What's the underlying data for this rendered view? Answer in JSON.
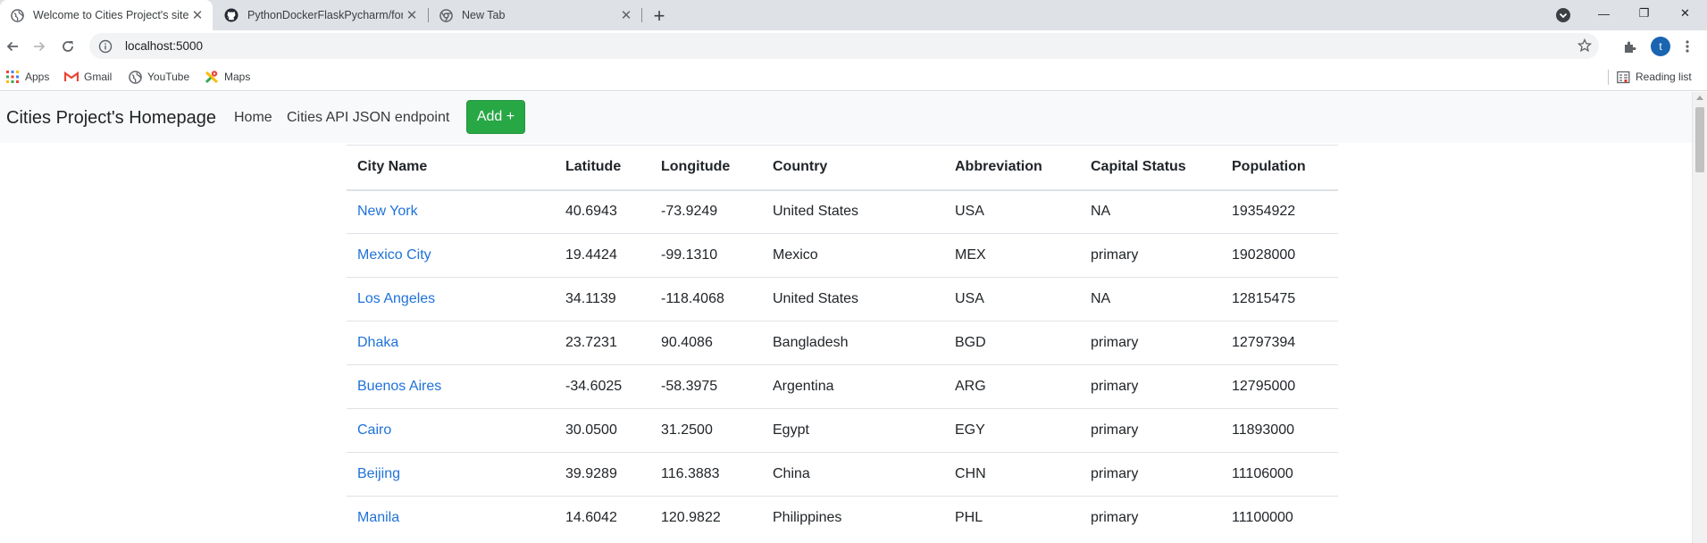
{
  "browser": {
    "tabs": [
      {
        "title": "Welcome to Cities Project's site",
        "icon": "globe-icon",
        "active": true
      },
      {
        "title": "PythonDockerFlaskPycharm/form",
        "icon": "github-icon",
        "active": false
      },
      {
        "title": "New Tab",
        "icon": "chrome-icon",
        "active": false
      }
    ],
    "close_glyph": "✕",
    "new_tab_glyph": "+",
    "window_controls": {
      "minimize": "—",
      "restore": "❐",
      "close": "✕"
    },
    "url": "localhost:5000",
    "profile_initial": "t",
    "bookmarks": [
      {
        "label": "Apps",
        "icon": "apps-grid-icon"
      },
      {
        "label": "Gmail",
        "icon": "gmail-icon"
      },
      {
        "label": "YouTube",
        "icon": "globe-icon"
      },
      {
        "label": "Maps",
        "icon": "maps-icon"
      }
    ],
    "reading_list": "Reading list"
  },
  "navbar": {
    "brand": "Cities Project's Homepage",
    "links": [
      "Home",
      "Cities API JSON endpoint"
    ],
    "add_button": "Add +"
  },
  "table": {
    "columns": [
      "City Name",
      "Latitude",
      "Longitude",
      "Country",
      "Abbreviation",
      "Capital Status",
      "Population"
    ],
    "rows": [
      [
        "New York",
        "40.6943",
        "-73.9249",
        "United States",
        "USA",
        "NA",
        "19354922"
      ],
      [
        "Mexico City",
        "19.4424",
        "-99.1310",
        "Mexico",
        "MEX",
        "primary",
        "19028000"
      ],
      [
        "Los Angeles",
        "34.1139",
        "-118.4068",
        "United States",
        "USA",
        "NA",
        "12815475"
      ],
      [
        "Dhaka",
        "23.7231",
        "90.4086",
        "Bangladesh",
        "BGD",
        "primary",
        "12797394"
      ],
      [
        "Buenos Aires",
        "-34.6025",
        "-58.3975",
        "Argentina",
        "ARG",
        "primary",
        "12795000"
      ],
      [
        "Cairo",
        "30.0500",
        "31.2500",
        "Egypt",
        "EGY",
        "primary",
        "11893000"
      ],
      [
        "Beijing",
        "39.9289",
        "116.3883",
        "China",
        "CHN",
        "primary",
        "11106000"
      ],
      [
        "Manila",
        "14.6042",
        "120.9822",
        "Philippines",
        "PHL",
        "primary",
        "11100000"
      ]
    ]
  },
  "colors": {
    "link": "#1f72d8",
    "add_button": "#28a745",
    "navbar_bg": "#f8f9fa",
    "tabstrip_bg": "#dee1e6",
    "profile": "#1a64b0"
  }
}
